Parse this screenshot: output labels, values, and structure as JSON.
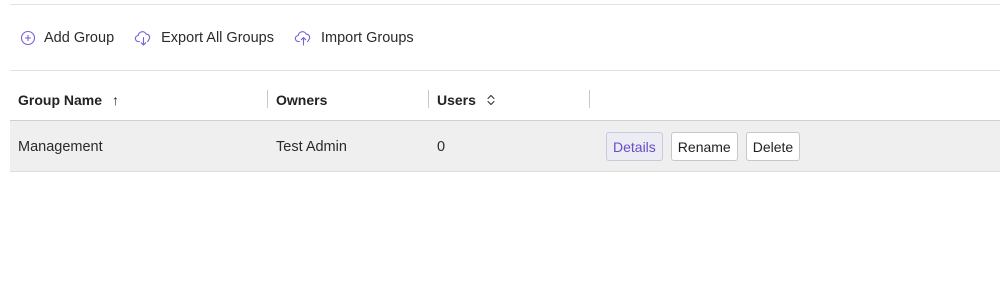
{
  "toolbar": {
    "add_group": "Add Group",
    "export_all": "Export All Groups",
    "import_groups": "Import Groups"
  },
  "table": {
    "headers": {
      "group_name": "Group Name",
      "group_name_sort": "↑",
      "owners": "Owners",
      "users": "Users"
    },
    "rows": [
      {
        "group_name": "Management",
        "owners": "Test Admin",
        "users": "0",
        "actions": {
          "details": "Details",
          "rename": "Rename",
          "delete": "Delete"
        }
      }
    ]
  },
  "colors": {
    "icon_accent": "#7b5fd6",
    "details_text": "#6a4cc4",
    "row_bg": "#efefef"
  },
  "icons": {
    "add_group": "plus-circle-icon",
    "export_all": "cloud-download-icon",
    "import_groups": "cloud-upload-icon",
    "users_sort": "sort-updown-icon"
  }
}
